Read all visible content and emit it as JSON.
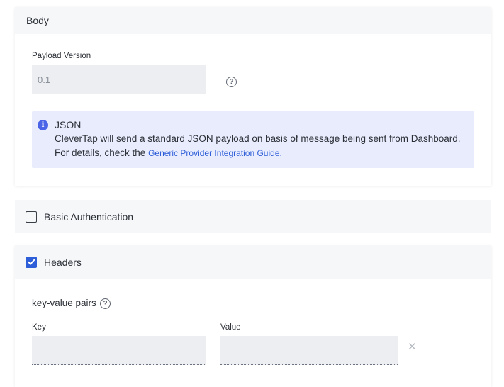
{
  "body_section": {
    "title": "Body",
    "payload_version_label": "Payload Version",
    "payload_version_value": "0.1",
    "info": {
      "title": "JSON",
      "line1": "CleverTap will send a standard JSON payload on basis of message being sent from Dashboard.",
      "line2_prefix": "For details, check the ",
      "link_text": "Generic Provider Integration Guide."
    }
  },
  "basic_auth": {
    "label": "Basic Authentication",
    "checked": false
  },
  "headers": {
    "label": "Headers",
    "checked": true,
    "kv_label": "key-value pairs",
    "key_label": "Key",
    "value_label": "Value",
    "key_value": "",
    "value_value": ""
  },
  "icons": {
    "help": "question-circle-icon",
    "info": "info-circle-icon",
    "remove": "close-icon",
    "check": "checkmark-icon"
  },
  "colors": {
    "accent": "#2f5fd8",
    "info_bg": "#e8ecfd",
    "input_bg": "#eceef2",
    "header_bg": "#f6f7f9"
  }
}
